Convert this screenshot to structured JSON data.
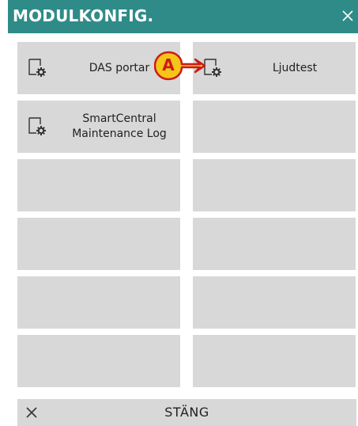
{
  "dialog": {
    "title": "MODULKONFIG.",
    "close_icon": "close-icon"
  },
  "tiles": [
    {
      "label": "DAS portar",
      "icon": "module-config-icon",
      "empty": false
    },
    {
      "label": "Ljudtest",
      "icon": "module-config-icon",
      "empty": false
    },
    {
      "label": "SmartCentral\nMaintenance Log",
      "icon": "module-config-icon",
      "empty": false
    },
    {
      "label": "",
      "empty": true
    },
    {
      "label": "",
      "empty": true
    },
    {
      "label": "",
      "empty": true
    },
    {
      "label": "",
      "empty": true
    },
    {
      "label": "",
      "empty": true
    },
    {
      "label": "",
      "empty": true
    },
    {
      "label": "",
      "empty": true
    },
    {
      "label": "",
      "empty": true
    },
    {
      "label": "",
      "empty": true
    }
  ],
  "annotation": {
    "letter": "A",
    "badge_color": "#f5c518",
    "outline_color": "#cc1a1a"
  },
  "footer": {
    "close_label": "STÄNG",
    "close_icon": "close-icon"
  },
  "colors": {
    "titlebar": "#2f8b88",
    "tile": "#d8d8d8"
  }
}
